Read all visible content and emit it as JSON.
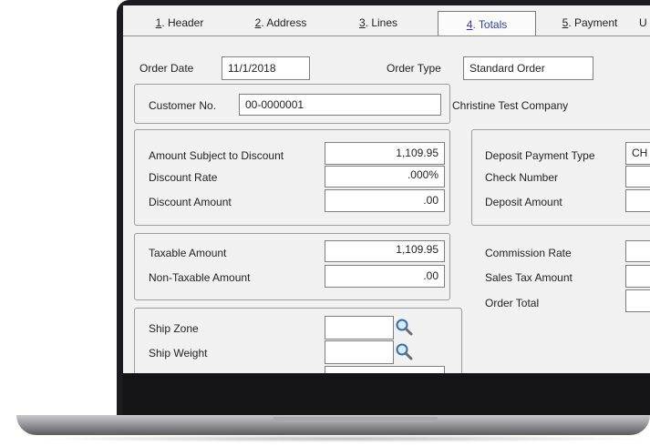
{
  "tabs": [
    {
      "key": "1",
      "rest": ". Header",
      "active": false
    },
    {
      "key": "2",
      "rest": ". Address",
      "active": false
    },
    {
      "key": "3",
      "rest": ". Lines",
      "active": false
    },
    {
      "key": "4",
      "rest": ". Totals",
      "active": true
    },
    {
      "key": "5",
      "rest": ". Payment",
      "active": false
    },
    {
      "key": "U",
      "rest": "",
      "active": false
    }
  ],
  "header": {
    "order_date_label": "Order Date",
    "order_date_value": "11/1/2018",
    "order_type_label": "Order Type",
    "order_type_value": "Standard Order",
    "customer_no_label": "Customer No.",
    "customer_no_value": "00-0000001",
    "customer_name": "Christine Test Company"
  },
  "discount": {
    "amount_subject_label": "Amount Subject to Discount",
    "amount_subject_value": "1,109.95",
    "rate_label": "Discount Rate",
    "rate_value": ".000%",
    "amount_label": "Discount Amount",
    "amount_value": ".00"
  },
  "deposit": {
    "payment_type_label": "Deposit Payment Type",
    "payment_type_value": "CH",
    "check_number_label": "Check Number",
    "amount_label": "Deposit Amount"
  },
  "tax": {
    "taxable_label": "Taxable Amount",
    "taxable_value": "1,109.95",
    "non_taxable_label": "Non-Taxable Amount",
    "non_taxable_value": ".00"
  },
  "totals": {
    "commission_label": "Commission Rate",
    "sales_tax_label": "Sales Tax Amount",
    "order_total_label": "Order Total"
  },
  "shipping": {
    "zone_label": "Ship Zone",
    "weight_label": "Ship Weight"
  },
  "icons": {
    "lookup": "magnifier-icon"
  }
}
